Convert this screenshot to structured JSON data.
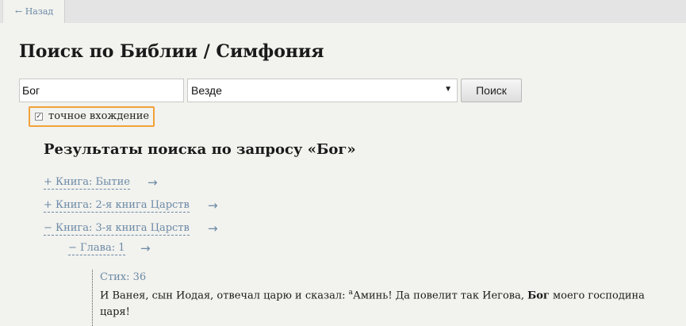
{
  "nav": {
    "back_label": "← Назад"
  },
  "page": {
    "title": "Поиск по Библии / Симфония"
  },
  "search": {
    "query": "Бог",
    "scope": "Везде",
    "button_label": "Поиск",
    "exact_match_label": "точное вхождение",
    "exact_match_checked": true
  },
  "results": {
    "heading": "Результаты поиска по запросу «Бог»",
    "books": [
      {
        "label": "+ Книга: Бытие",
        "arrow": "→"
      },
      {
        "label": "+ Книга: 2-я книга Царств",
        "arrow": "→"
      },
      {
        "label": "− Книга: 3-я книга Царств",
        "arrow": "→"
      }
    ],
    "chapter": {
      "label": "− Глава: 1",
      "arrow": "→"
    },
    "verse": {
      "ref": "Стих: 36",
      "text_before": "И Ванея, сын Иодая, отвечал царю и сказал: ",
      "footnote": "a",
      "text_middle": "Аминь! Да повелит так Иегова, ",
      "highlight": "Бог",
      "text_after": " моего господина царя!"
    }
  },
  "colors": {
    "link": "#6b8aa6",
    "focus": "#f0a23a",
    "background": "#f2f2ee"
  }
}
